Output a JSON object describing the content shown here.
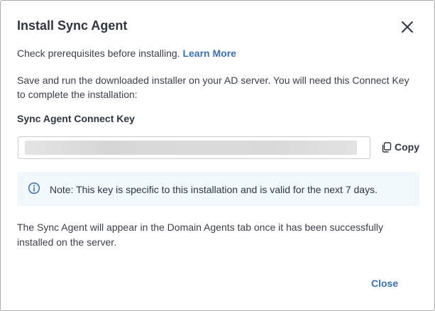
{
  "dialog": {
    "title": "Install Sync Agent",
    "prerequisites_text": "Check prerequisites before installing.",
    "learn_more_label": "Learn More",
    "description": "Save and run the downloaded installer on your AD server. You will need this Connect Key to complete the installation:",
    "key_label": "Sync Agent Connect Key",
    "copy_label": "Copy",
    "note_text": "Note: This key is specific to this installation and is valid for the next 7 days.",
    "footer_text": "The Sync Agent will appear in the Domain Agents tab once it has been successfully installed on the server.",
    "close_label": "Close"
  },
  "icons": {
    "close": "close-icon",
    "copy": "copy-icon",
    "info": "info-icon"
  },
  "colors": {
    "accent": "#3a70b8",
    "note_background": "#f0f8fc",
    "text": "#2f3640"
  }
}
